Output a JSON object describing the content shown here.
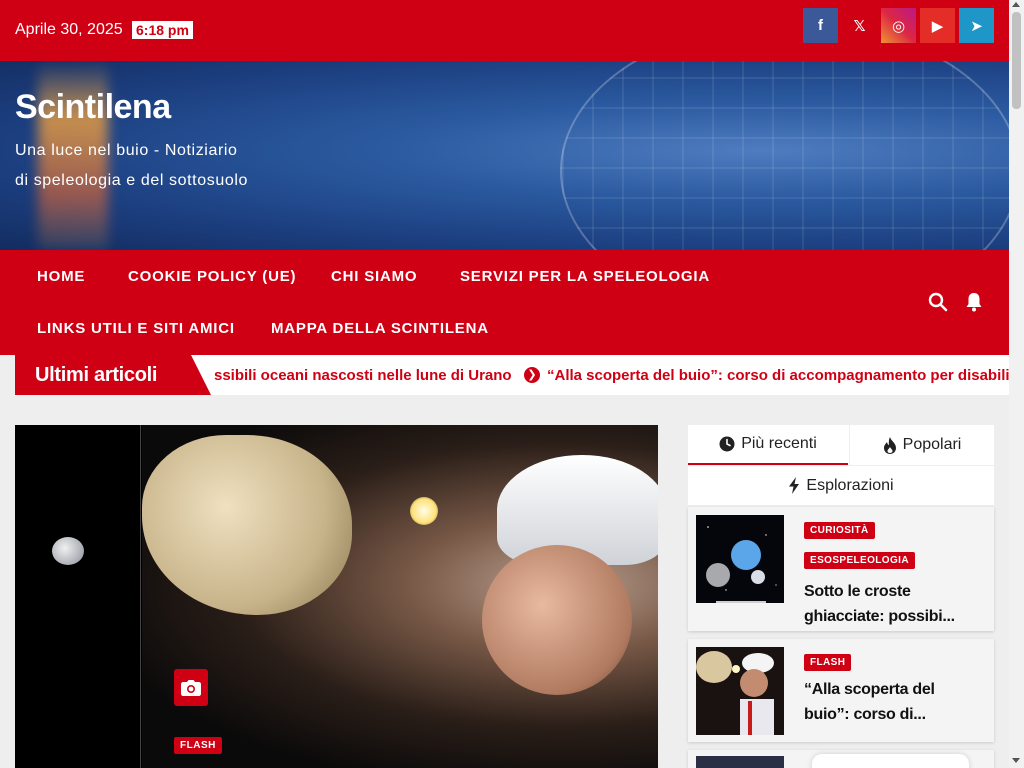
{
  "topbar": {
    "date": "Aprile 30, 2025",
    "time": "6:18 pm",
    "social": [
      {
        "name": "facebook-icon",
        "glyph": "f"
      },
      {
        "name": "x-twitter-icon",
        "glyph": "𝕏"
      },
      {
        "name": "instagram-icon",
        "glyph": "◎"
      },
      {
        "name": "youtube-icon",
        "glyph": "▶"
      },
      {
        "name": "telegram-icon",
        "glyph": "➤"
      }
    ]
  },
  "header": {
    "site_title": "Scintilena",
    "tagline": "Una luce nel buio - Notiziario di speleologia e del sottosuolo"
  },
  "nav": {
    "items": [
      "HOME",
      "COOKIE POLICY (UE)",
      "CHI SIAMO",
      "SERVIZI PER LA SPELEOLOGIA",
      "LINKS UTILI E SITI AMICI",
      "MAPPA DELLA SCINTILENA"
    ]
  },
  "ticker": {
    "label": "Ultimi articoli",
    "item1": "ssibili oceani nascosti nelle lune di Urano",
    "item2": "“Alla scoperta del buio”: corso di accompagnamento per disabili"
  },
  "feature": {
    "category": "FLASH"
  },
  "sidebar": {
    "tabs": [
      "Più recenti",
      "Popolari",
      "Esplorazioni"
    ],
    "posts": [
      {
        "categories": [
          "CURIOSITÀ",
          "ESOSPELEOLOGIA"
        ],
        "title_line1": "Sotto le croste",
        "title_line2": "ghiacciate: possibi..."
      },
      {
        "categories": [
          "FLASH"
        ],
        "title_line1": "“Alla scoperta del",
        "title_line2": "buio”: corso di..."
      }
    ]
  },
  "colors": {
    "brand_red": "#cf0014",
    "facebook": "#3b5998",
    "youtube": "#e52d27",
    "telegram": "#1e96c8"
  }
}
